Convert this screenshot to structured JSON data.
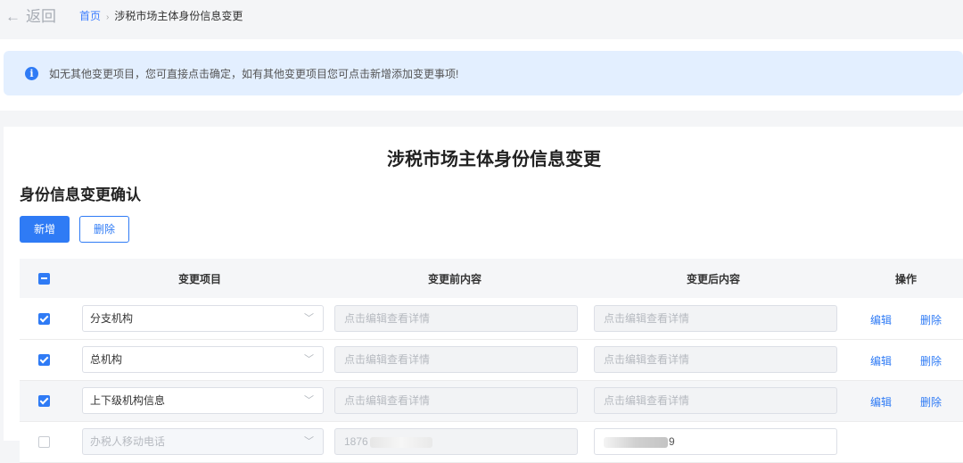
{
  "topbar": {
    "back_label": "返回",
    "breadcrumb": {
      "home": "首页",
      "separator": "›",
      "current": "涉税市场主体身份信息变更"
    }
  },
  "notice": {
    "icon": "info-icon",
    "text": "如无其他变更项目，您可直接点击确定，如有其他变更项目您可点击新增添加变更事项!"
  },
  "page_title": "涉税市场主体身份信息变更",
  "section_title": "身份信息变更确认",
  "toolbar": {
    "add_label": "新增",
    "delete_label": "删除"
  },
  "colors": {
    "accent": "#2f7bf5",
    "notice_bg": "#e3efff"
  },
  "table": {
    "header_checkbox": "partial",
    "columns": [
      "变更项目",
      "变更前内容",
      "变更后内容",
      "操作"
    ],
    "rows": [
      {
        "checked": true,
        "item": "分支机构",
        "before": "点击编辑查看详情",
        "after": "点击编辑查看详情",
        "edit": "编辑",
        "delete": "删除"
      },
      {
        "checked": true,
        "item": "总机构",
        "before": "点击编辑查看详情",
        "after": "点击编辑查看详情",
        "edit": "编辑",
        "delete": "删除"
      },
      {
        "checked": true,
        "item": "上下级机构信息",
        "before": "点击编辑查看详情",
        "after": "点击编辑查看详情",
        "edit": "编辑",
        "delete": "删除"
      },
      {
        "checked": false,
        "item": "办税人移动电话",
        "before": "1876",
        "after": "9",
        "edit": "",
        "delete": ""
      }
    ]
  }
}
